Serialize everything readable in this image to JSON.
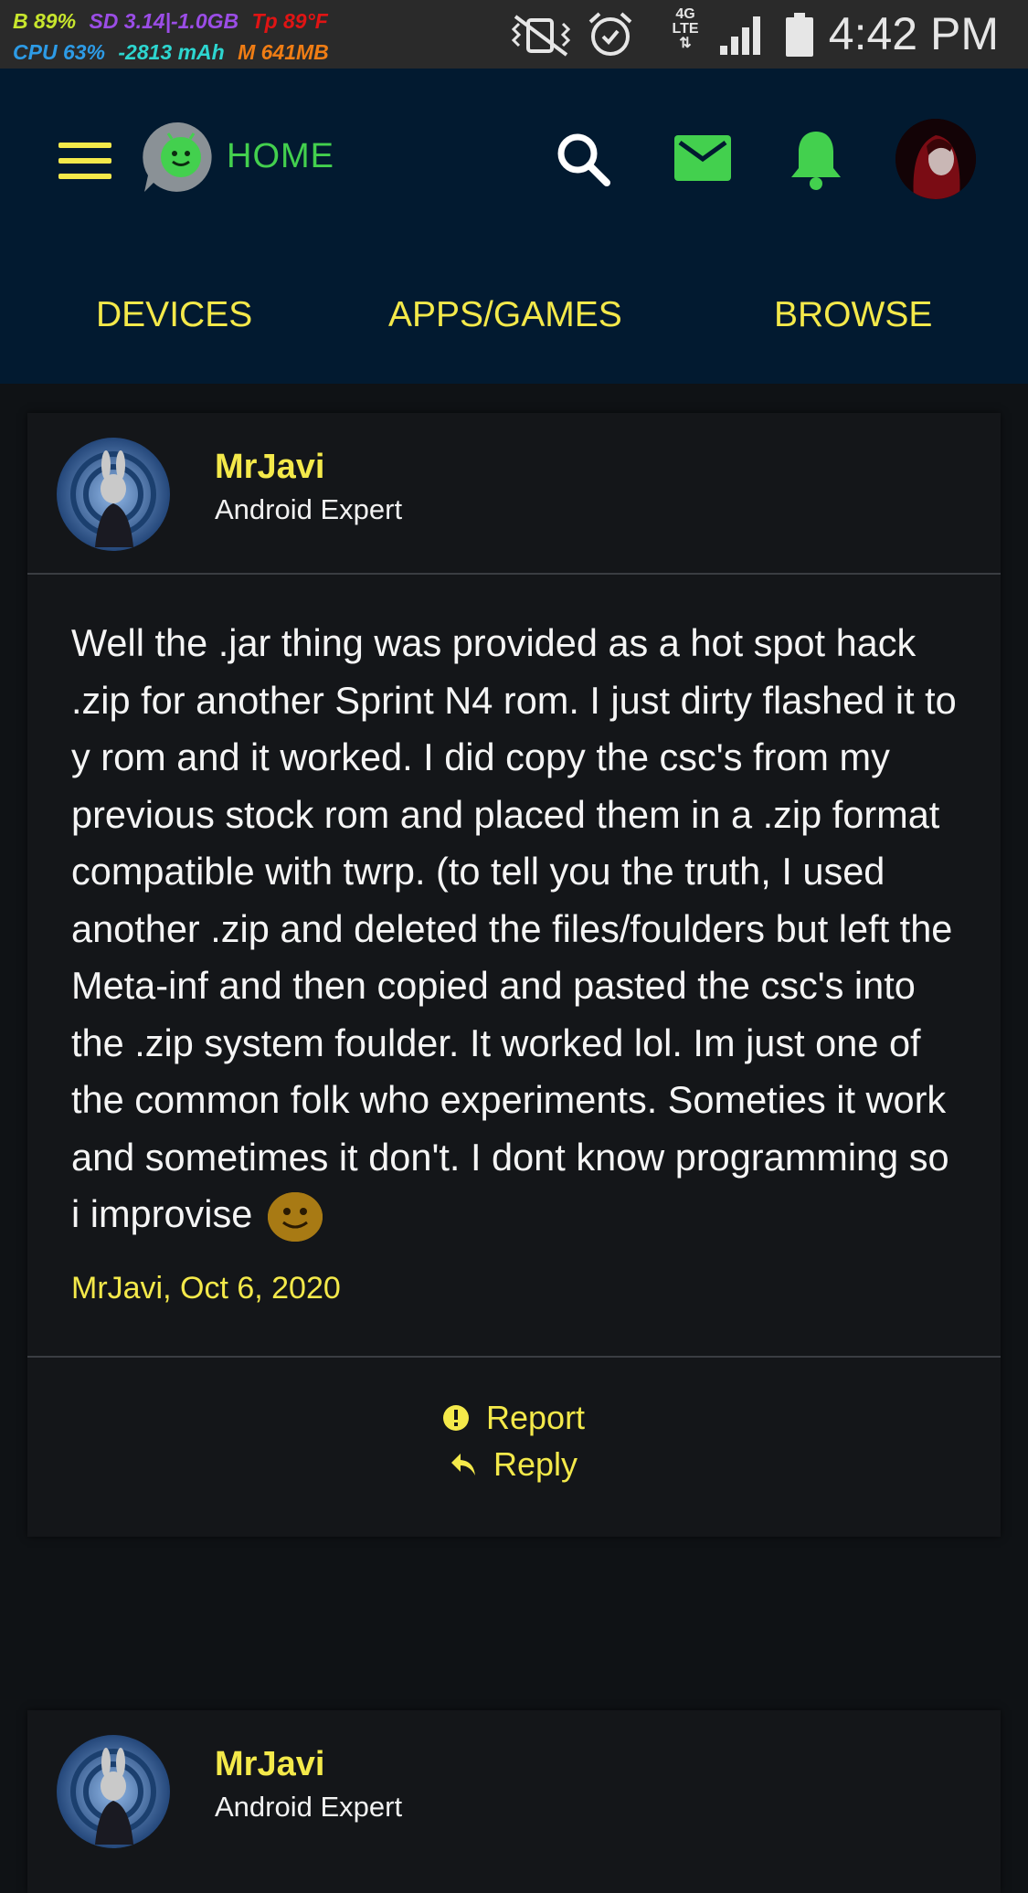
{
  "status_bar": {
    "battery_stat": "B 89%",
    "sd_stat": "SD 3.14|-1.0GB",
    "temp_stat": "Tp 89°F",
    "cpu_stat": "CPU 63%",
    "current_stat": "-2813 mAh",
    "mem_stat": "M 641MB",
    "network": "4G LTE",
    "time": "4:42 PM",
    "colors": {
      "battery": "#c8e62d",
      "sd": "#9b4de6",
      "temp": "#e01414",
      "cpu": "#2d9be6",
      "current": "#2dd6d0",
      "mem": "#f07d14"
    }
  },
  "header": {
    "home_label": "HOME",
    "icons": [
      "menu-icon",
      "forum-logo-icon",
      "search-icon",
      "mail-icon",
      "bell-icon",
      "avatar"
    ],
    "colors": {
      "background": "#021a30",
      "accent": "#f4e94a",
      "green": "#43d04e"
    }
  },
  "nav": {
    "tabs": [
      {
        "label": "DEVICES"
      },
      {
        "label": "APPS/GAMES"
      },
      {
        "label": "BROWSE"
      }
    ]
  },
  "posts": [
    {
      "author": "MrJavi",
      "role": "Android Expert",
      "body": "Well the .jar thing was provided as a hot spot hack .zip for another Sprint N4 rom. I just dirty flashed it to y rom and it worked. I did copy the csc's from my previous stock rom and placed them in a .zip format compatible with twrp. (to tell you the truth, I used another .zip and deleted the files/foulders but left the Meta-inf and then copied and pasted the csc's into the .zip system foulder. It worked lol. Im just one of the common folk who experiments. Someties it work and sometimes it don't. I dont know programming so i improvise",
      "meta": "MrJavi, Oct 6, 2020",
      "actions": {
        "report": "Report",
        "reply": "Reply"
      }
    },
    {
      "author": "MrJavi",
      "role": "Android Expert"
    }
  ]
}
